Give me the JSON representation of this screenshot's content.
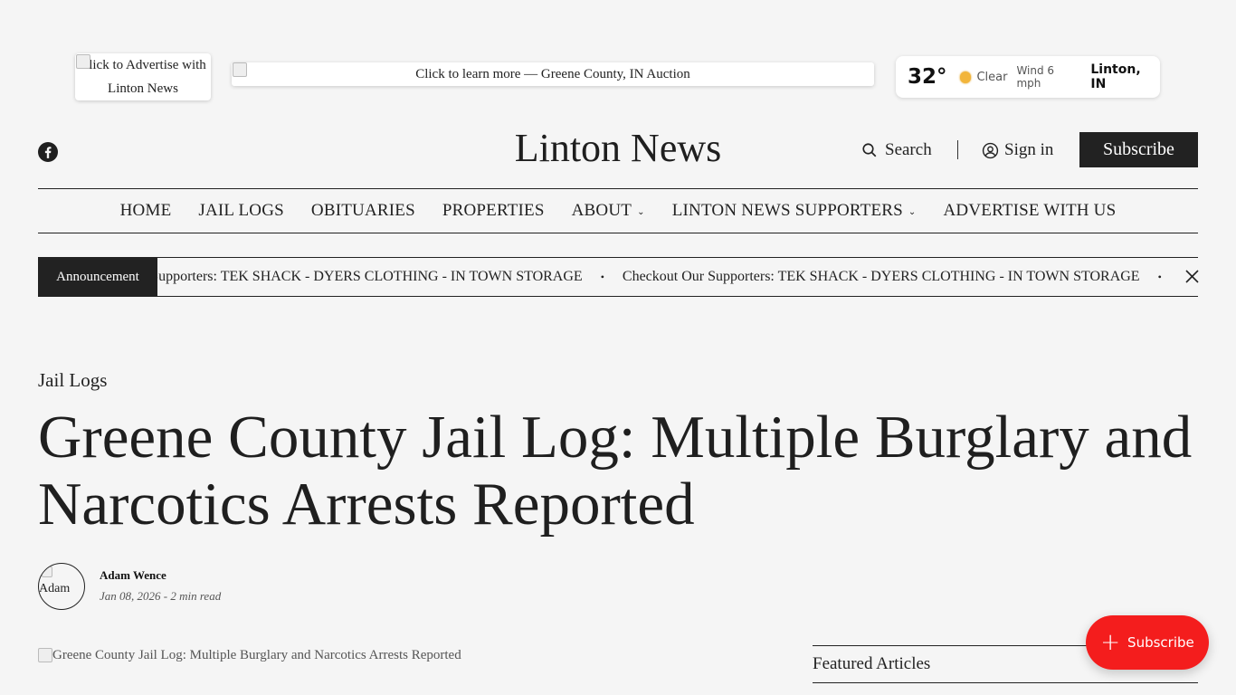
{
  "ads": {
    "small_alt": "Click to Advertise with Linton News",
    "banner_alt": "Click to learn more — Greene County, IN Auction"
  },
  "weather": {
    "temp": "32°",
    "condition": "Clear",
    "wind": "Wind 6 mph",
    "location": "Linton, IN",
    "icon": "sun-icon"
  },
  "header": {
    "brand": "Linton News",
    "search_label": "Search",
    "signin_label": "Sign in",
    "subscribe_label": "Subscribe",
    "social_icon": "facebook-icon"
  },
  "nav": {
    "items": [
      {
        "label": "HOME",
        "dropdown": false
      },
      {
        "label": "JAIL LOGS",
        "dropdown": false
      },
      {
        "label": "OBITUARIES",
        "dropdown": false
      },
      {
        "label": "PROPERTIES",
        "dropdown": false
      },
      {
        "label": "ABOUT",
        "dropdown": true
      },
      {
        "label": "LINTON NEWS SUPPORTERS",
        "dropdown": true
      },
      {
        "label": "ADVERTISE WITH US",
        "dropdown": false
      }
    ]
  },
  "announcement": {
    "label": "Announcement",
    "ticker_1": "Checkout Our Supporters: TEK SHACK - DYERS CLOTHING - IN TOWN STORAGE",
    "ticker_2": "Checkout Our Supporters: TEK SHACK - DYERS CLOTHING - IN TOWN STORAGE",
    "separator": "•"
  },
  "article": {
    "category": "Jail Logs",
    "title": "Greene County Jail Log: Multiple Burglary and Narcotics Arrests Reported",
    "author_avatar_alt": "Adam",
    "author": "Adam Wence",
    "meta": "Jan 08, 2026 - 2 min read",
    "hero_alt": "Greene County Jail Log: Multiple Burglary and Narcotics Arrests Reported"
  },
  "sidebar": {
    "featured_title": "Featured Articles"
  },
  "portal": {
    "label": "Subscribe",
    "color": "#f41d1d"
  }
}
